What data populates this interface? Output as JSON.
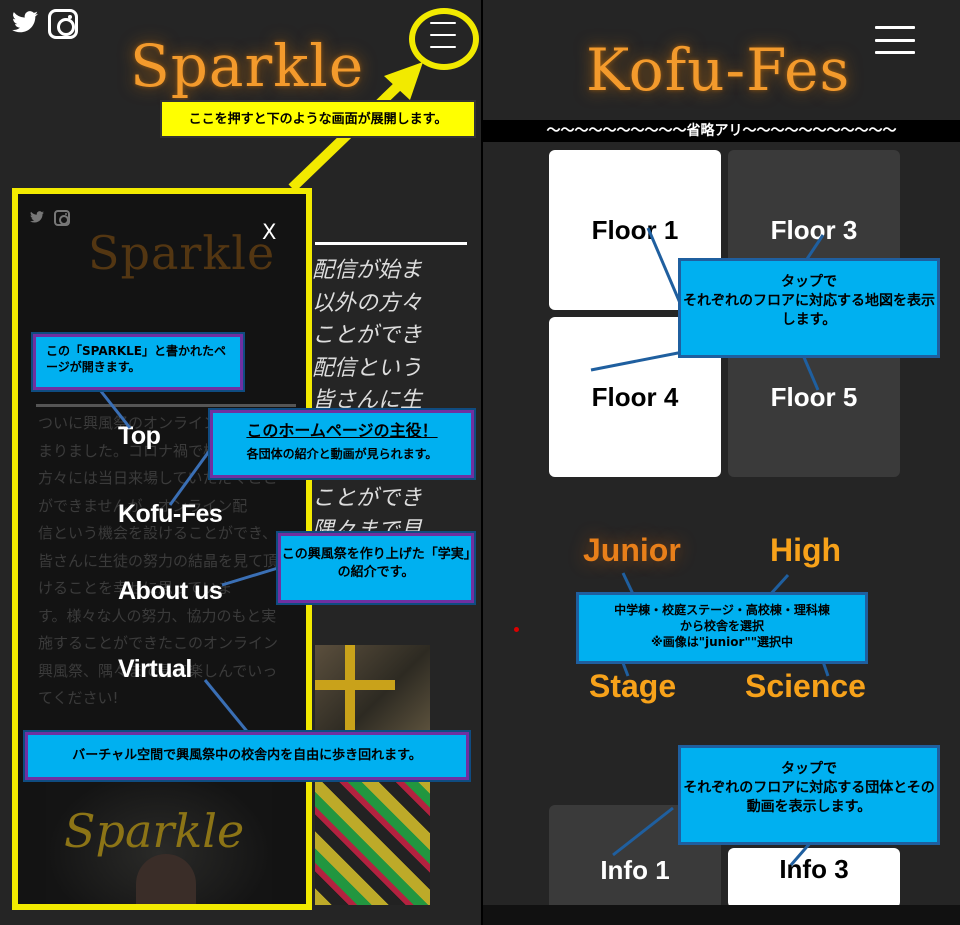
{
  "left": {
    "logo": "Sparkle",
    "callout_tap": "ここを押すと下のような画面が展開します。",
    "background_text": [
      "配信が始ま",
      "以外の方々",
      "ことができ",
      "配信という",
      "皆さんに生",
      "",
      "",
      "ことができ",
      "隅々まで見"
    ],
    "menu": {
      "logo": "Sparkle",
      "close": "X",
      "items": [
        "Top",
        "Kofu-Fes",
        "About us",
        "Virtual"
      ],
      "background_text": "ついに興風祭のオンライン配信が始\nまりました。コロナ禍で校内外の\n方々には当日来場していただくこと\nができませんが、オンライン配\n信という機会を設けることができ、\n皆さんに生徒の努力の結晶を見て頂\nけることを幸せに思っていま\nす。様々な人の努力、協力のもと実\n施することができたこのオンライン\n興風祭、隅々まで見て楽しんでいっ\nてください!"
    },
    "notes": {
      "sparkle": "この「SPARKLE」と書かれたページが開きます。",
      "main_title": "このホームページの主役！",
      "main_sub": "各団体の紹介と動画が見られます。",
      "gakujitsu": "この興風祭を作り上げた「学実」の紹介です。",
      "virtual": "バーチャル空間で興風祭中の校舎内を自由に歩き回れます。"
    }
  },
  "right": {
    "logo": "Kofu-Fes",
    "omitted_banner": "〜〜〜〜〜〜〜〜〜〜省略アリ〜〜〜〜〜〜〜〜〜〜〜",
    "floor_tiles": [
      "Floor 1",
      "Floor 3",
      "Floor 4",
      "Floor 5"
    ],
    "campus_buttons": [
      "Junior",
      "High",
      "Stage",
      "Science"
    ],
    "info_tiles": [
      "Info 1",
      "Info 3"
    ],
    "notes": {
      "floor": "タップで\nそれぞれのフロアに対応する地図を表示します。",
      "campus": "中学棟・校庭ステージ・高校棟・理科棟\nから校舎を選択\n※画像は\"junior\"\"選択中",
      "info": "タップで\nそれぞれのフロアに対応する団体とその動画を表示します。"
    }
  },
  "colors": {
    "callout_yellow": "#f2ea00",
    "note_blue": "#00b0f0",
    "logo_orange": "#f39a2c"
  }
}
